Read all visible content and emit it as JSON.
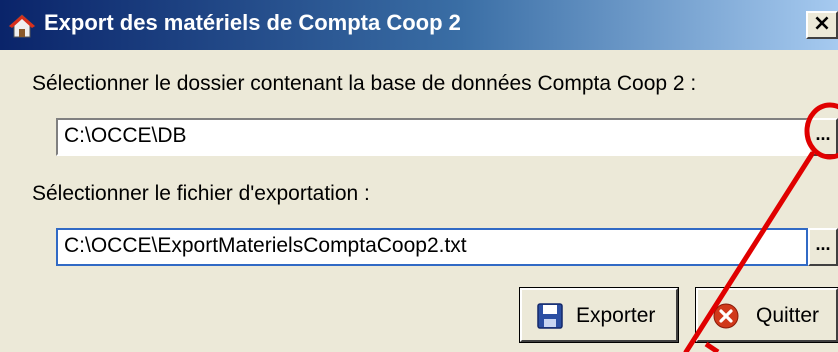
{
  "window": {
    "title": "Export des matériels de Compta Coop 2",
    "close_label": "×"
  },
  "database": {
    "label": "Sélectionner le dossier contenant la base de données Compta Coop 2 :",
    "value": "C:\\OCCE\\DB",
    "browse_label": "..."
  },
  "export_file": {
    "label": "Sélectionner le fichier d'exportation :",
    "value": "C:\\OCCE\\ExportMaterielsComptaCoop2.txt",
    "browse_label": "..."
  },
  "buttons": {
    "export_label": "Exporter",
    "quit_label": "Quitter"
  },
  "colors": {
    "annotation": "#e00000",
    "title_bar": "#0a246a",
    "dialog_bg": "#ece9d8"
  }
}
